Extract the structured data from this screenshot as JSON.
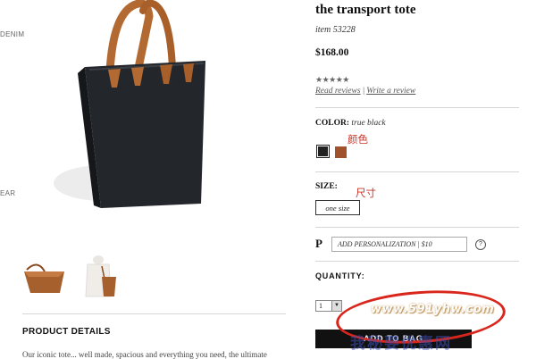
{
  "left_nav": [
    "DENIM",
    "EAR"
  ],
  "product": {
    "title": "the transport tote",
    "item_number": "item 53228",
    "price": "$168.00",
    "stars": "★★★★★",
    "rating": 4.5,
    "read_reviews": "Read reviews",
    "separator": "|",
    "write_review": "Write a review"
  },
  "color": {
    "label": "COLOR:",
    "value": "true black",
    "swatches": [
      {
        "name": "true black",
        "hex": "#222222",
        "selected": true
      },
      {
        "name": "brown",
        "hex": "#a0522d",
        "selected": false
      }
    ]
  },
  "size": {
    "label": "SIZE:",
    "option": "one size"
  },
  "personalization": {
    "letter": "P",
    "button": "ADD PERSONALIZATION | $10",
    "info": "?"
  },
  "quantity": {
    "label": "QUANTITY:",
    "value": "1",
    "arrow": "▼"
  },
  "add_to_bag": "ADD TO BAG",
  "details": {
    "title": "PRODUCT DETAILS",
    "text": "Our iconic tote... well made, spacious and everything you need, the ultimate"
  },
  "annotations": {
    "color_cn": "颜色",
    "size_cn": "尺寸"
  },
  "watermark": {
    "url": "www.591yhw.com",
    "cn": "我秘要优惠网"
  },
  "colors": {
    "accent_red": "#c8362a",
    "button_black": "#111111",
    "bag_black": "#1f2227",
    "strap_tan": "#b36a32"
  }
}
